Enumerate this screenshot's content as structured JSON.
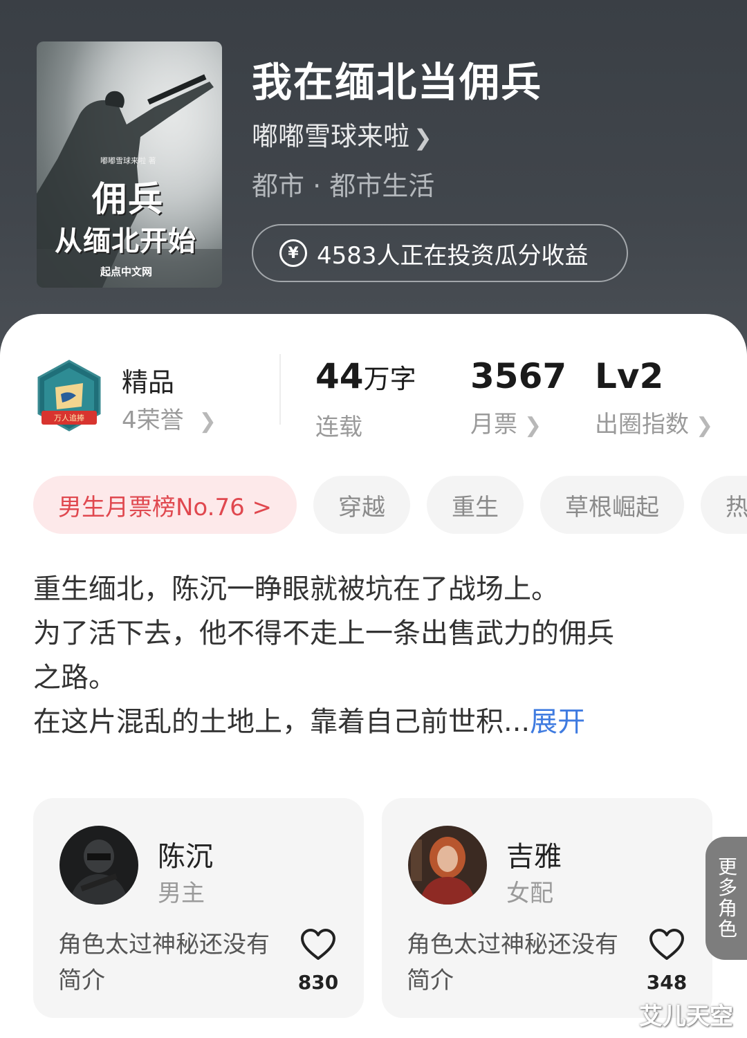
{
  "header": {
    "cover": {
      "author_credit": "嘟嘟雪球来啦 著",
      "title_line1": "佣兵",
      "title_line2": "从缅北开始",
      "publisher": "起点中文网"
    },
    "book_title": "我在缅北当佣兵",
    "author": "嘟嘟雪球来啦",
    "genre": "都市 · 都市生活",
    "invest_text": "4583人正在投资瓜分收益",
    "invest_icon": "¥"
  },
  "honor": {
    "title": "精品",
    "subtitle": "4荣誉",
    "badge_ribbon": "万人追捧"
  },
  "stats": {
    "words_num": "44",
    "words_unit": "万字",
    "words_label": "连载",
    "monthly_num": "3567",
    "monthly_label": "月票",
    "level_num": "Lv2",
    "level_label": "出圈指数"
  },
  "tags": {
    "rank": "男生月票榜No.76 >",
    "items": [
      "穿越",
      "重生",
      "草根崛起",
      "热"
    ]
  },
  "description": {
    "line1": "重生缅北，陈沉一睁眼就被坑在了战场上。",
    "line2": "为了活下去，他不得不走上一条出售武力的佣兵",
    "line3": "之路。",
    "line4": "在这片混乱的土地上，靠着自己前世积...",
    "expand": "展开"
  },
  "characters": [
    {
      "name": "陈沉",
      "role": "男主",
      "intro": "角色太过神秘还没有简介",
      "likes": "830"
    },
    {
      "name": "吉雅",
      "role": "女配",
      "intro": "角色太过神秘还没有简介",
      "likes": "348"
    }
  ],
  "more_roles": [
    "更",
    "多",
    "角",
    "色"
  ],
  "watermark": "艾儿天空",
  "colors": {
    "header_bg": "#3a3f45",
    "rank_tag_bg": "#fde9ea",
    "rank_tag_text": "#e0484f",
    "expand_link": "#3f7be0"
  }
}
